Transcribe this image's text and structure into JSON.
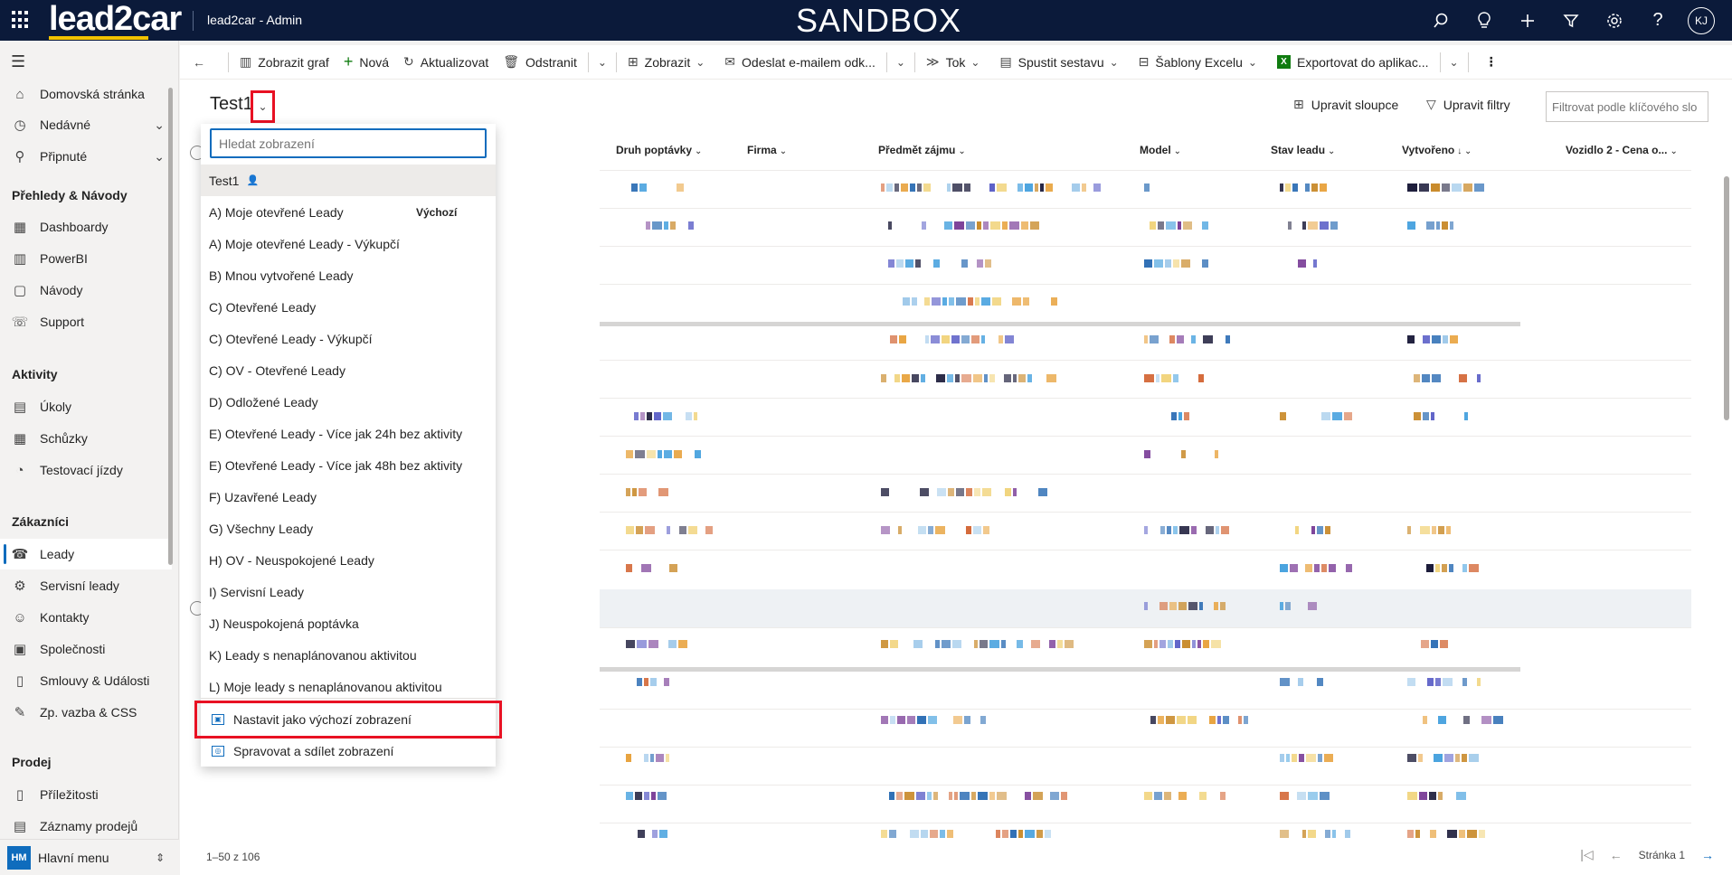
{
  "topbar": {
    "brand": "lead2car",
    "app_title": "lead2car - Admin",
    "environment": "SANDBOX",
    "user_initials": "KJ",
    "icons": [
      "search-icon",
      "lightbulb-icon",
      "plus-icon",
      "filter-icon",
      "gear-icon",
      "help-icon"
    ]
  },
  "leftnav": {
    "items": [
      {
        "label": "Domovská stránka",
        "icon": "home-icon"
      },
      {
        "label": "Nedávné",
        "icon": "clock-icon"
      },
      {
        "label": "Připnuté",
        "icon": "pin-icon"
      },
      {
        "label": "Dashboardy",
        "icon": "dashboard-icon"
      },
      {
        "label": "PowerBI",
        "icon": "chart-icon"
      },
      {
        "label": "Návody",
        "icon": "help-box-icon"
      },
      {
        "label": "Support",
        "icon": "support-icon"
      },
      {
        "label": "Úkoly",
        "icon": "task-icon"
      },
      {
        "label": "Schůzky",
        "icon": "calendar-icon"
      },
      {
        "label": "Testovací jízdy",
        "icon": "gauge-icon"
      },
      {
        "label": "Leady",
        "icon": "phone-person-icon"
      },
      {
        "label": "Servisní leady",
        "icon": "service-icon"
      },
      {
        "label": "Kontakty",
        "icon": "person-icon"
      },
      {
        "label": "Společnosti",
        "icon": "building-icon"
      },
      {
        "label": "Smlouvy & Události",
        "icon": "document-icon"
      },
      {
        "label": "Zp. vazba & CSS",
        "icon": "feedback-icon"
      },
      {
        "label": "Příležitosti",
        "icon": "opportunity-icon"
      },
      {
        "label": "Záznamy prodejů",
        "icon": "sales-icon"
      }
    ],
    "headings": [
      "Přehledy & Návody",
      "Aktivity",
      "Zákazníci",
      "Prodej"
    ],
    "area_badge": "HM",
    "area_label": "Hlavní menu"
  },
  "commandbar": {
    "items": [
      {
        "label": "Zobrazit graf",
        "icon": "chart-icon"
      },
      {
        "label": "Nová",
        "icon": "plus-icon"
      },
      {
        "label": "Aktualizovat",
        "icon": "refresh-icon"
      },
      {
        "label": "Odstranit",
        "icon": "trash-icon"
      },
      {
        "label": "Zobrazit",
        "icon": "view-icon"
      },
      {
        "label": "Odeslat e-mailem odk...",
        "icon": "email-link-icon"
      },
      {
        "label": "Tok",
        "icon": "flow-icon"
      },
      {
        "label": "Spustit sestavu",
        "icon": "report-icon"
      },
      {
        "label": "Šablony Excelu",
        "icon": "excel-template-icon"
      },
      {
        "label": "Exportovat do aplikac...",
        "icon": "excel-icon"
      }
    ]
  },
  "view": {
    "title": "Test1",
    "edit_columns": "Upravit sloupce",
    "edit_filters": "Upravit filtry",
    "filter_placeholder": "Filtrovat podle klíčového slo"
  },
  "grid": {
    "columns": [
      "Druh poptávky",
      "Firma",
      "Předmět zájmu",
      "Model",
      "Stav leadu",
      "Vytvořeno",
      "Vozidlo 2 - Cena o..."
    ],
    "pager_info": "1–50 z 106",
    "page_label": "Stránka 1"
  },
  "dropdown": {
    "search_placeholder": "Hledat zobrazení",
    "current": "Test1",
    "default_label": "Výchozí",
    "views": [
      "A) Moje otevřené Leady",
      "A) Moje otevřené Leady - Výkupčí",
      "B) Mnou vytvořené Leady",
      "C) Otevřené Leady",
      "C) Otevřené Leady - Výkupčí",
      "C) OV - Otevřené Leady",
      "D) Odložené Leady",
      "E) Otevřené Leady - Více jak 24h bez aktivity",
      "E) Otevřené Leady - Více jak 48h bez aktivity",
      "F) Uzavřené Leady",
      "G) Všechny Leady",
      "H) OV - Neuspokojené Leady",
      "I) Servisní Leady",
      "J) Neuspokojená poptávka",
      "K) Leady s nenaplánovanou aktivitou",
      "L) Moje leady s nenaplánovanou aktivitou"
    ],
    "set_default": "Nastavit jako výchozí zobrazení",
    "manage_share": "Spravovat a sdílet zobrazení"
  }
}
